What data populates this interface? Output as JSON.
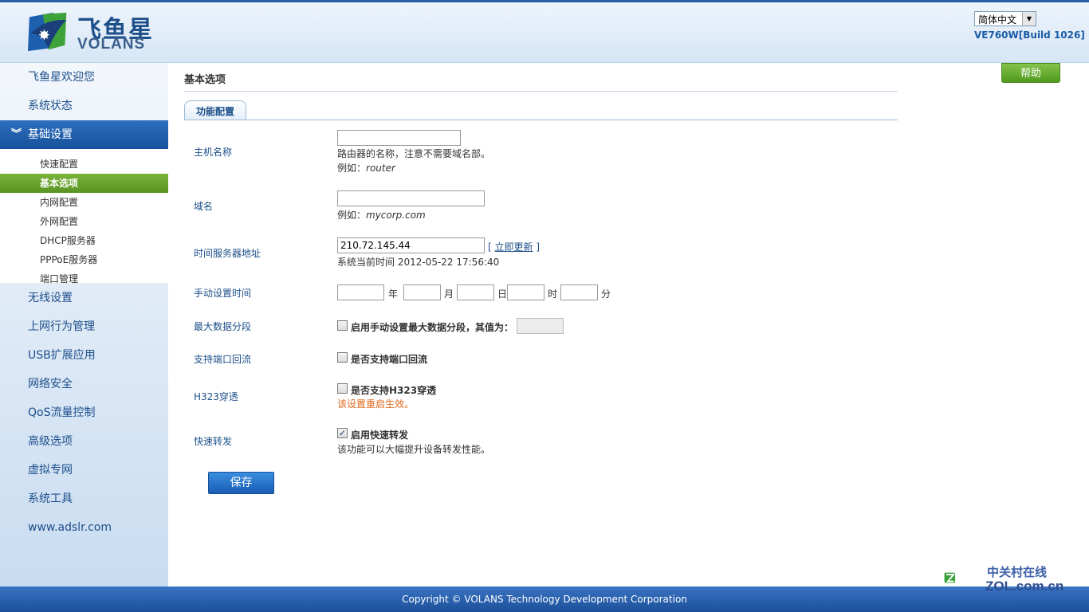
{
  "header": {
    "brand_cn": "飞鱼星",
    "brand_en": "VOLANS",
    "language": "简体中文",
    "version": "VE760W[Build 1026]",
    "help": "帮助"
  },
  "sidebar": {
    "items": [
      {
        "label": "飞鱼星欢迎您"
      },
      {
        "label": "系统状态"
      },
      {
        "label": "基础设置",
        "active": true
      },
      {
        "label": "无线设置"
      },
      {
        "label": "上网行为管理"
      },
      {
        "label": "USB扩展应用"
      },
      {
        "label": "网络安全"
      },
      {
        "label": "QoS流量控制"
      },
      {
        "label": "高级选项"
      },
      {
        "label": "虚拟专网"
      },
      {
        "label": "系统工具"
      },
      {
        "label": "www.adslr.com"
      }
    ],
    "submenu": [
      {
        "label": "快速配置"
      },
      {
        "label": "基本选项",
        "active": true
      },
      {
        "label": "内网配置"
      },
      {
        "label": "外网配置"
      },
      {
        "label": "DHCP服务器"
      },
      {
        "label": "PPPoE服务器"
      },
      {
        "label": "端口管理"
      }
    ]
  },
  "main": {
    "title": "基本选项",
    "tab": "功能配置",
    "hostname": {
      "label": "主机名称",
      "value": "",
      "hint": "路由器的名称，注意不需要域名部。",
      "example_prefix": "例如：",
      "example": "router"
    },
    "domain": {
      "label": "域名",
      "value": "",
      "example_prefix": "例如：",
      "example": "mycorp.com"
    },
    "ntp": {
      "label": "时间服务器地址",
      "value": "210.72.145.44",
      "bracket_open": "[",
      "update_link": "立即更新",
      "bracket_close": "]",
      "current_time": "系统当前时间 2012-05-22 17:56:40"
    },
    "manual_time": {
      "label": "手动设置时间",
      "year": "年",
      "month": "月",
      "day": "日",
      "hour": "时",
      "minute": "分"
    },
    "mss": {
      "label": "最大数据分段",
      "checkbox_label": "启用手动设置最大数据分段，其值为：",
      "checked": false,
      "value": ""
    },
    "loopback": {
      "label": "支持端口回流",
      "checkbox_label": "是否支持端口回流",
      "checked": false
    },
    "h323": {
      "label": "H323穿透",
      "checkbox_label": "是否支持H323穿透",
      "checked": false,
      "warning": "该设置重启生效。"
    },
    "fast_forward": {
      "label": "快速转发",
      "checkbox_label": "启用快速转发",
      "checked": true,
      "hint": "该功能可以大幅提升设备转发性能。"
    },
    "save": "保存"
  },
  "footer": {
    "copyright": "Copyright © VOLANS Technology Development Corporation"
  },
  "watermark": {
    "cn": "中关村在线",
    "en": "ZOL.com.cn"
  },
  "colors": {
    "accent_blue": "#1d4f8a",
    "active_green": "#5a9422",
    "warning_orange": "#e0681a"
  }
}
